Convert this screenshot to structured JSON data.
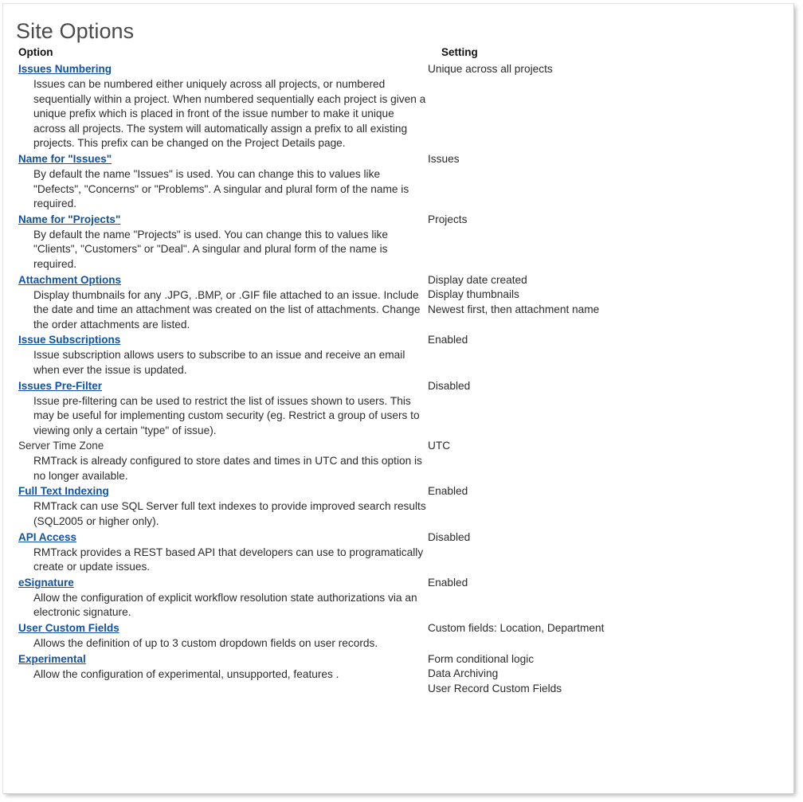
{
  "page": {
    "title": "Site Options",
    "link_color": "#1152a5",
    "text_color": "#2b2b2b",
    "title_color": "#4a4a4a",
    "background": "#ffffff"
  },
  "columns": {
    "option_header": "Option",
    "setting_header": "Setting"
  },
  "rows": [
    {
      "name": "Issues Numbering",
      "is_link": true,
      "description": "Issues can be numbered either uniquely across all projects, or numbered sequentially within a project. When numbered sequentially each project is given a unique prefix which is placed in front of the issue number to make it unique across all projects. The system will automatically assign a prefix to all existing projects. This prefix can be changed on the Project Details page.",
      "settings": [
        "Unique across all projects"
      ]
    },
    {
      "name": "Name for \"Issues\"",
      "is_link": true,
      "description": "By default the name \"Issues\" is used. You can change this to values like \"Defects\", \"Concerns\" or \"Problems\". A singular and plural form of the name is required.",
      "settings": [
        "Issues"
      ]
    },
    {
      "name": "Name for \"Projects\"",
      "is_link": true,
      "description": "By default the name \"Projects\" is used. You can change this to values like \"Clients\", \"Customers\" or \"Deal\". A singular and plural form of the name is required.",
      "settings": [
        "Projects"
      ]
    },
    {
      "name": "Attachment Options",
      "is_link": true,
      "description": "Display thumbnails for any .JPG, .BMP, or .GIF file attached to an issue. Include the date and time an attachment was created on the list of attachments. Change the order attachments are listed.",
      "settings": [
        "Display date created",
        "Display thumbnails",
        "Newest first, then attachment name"
      ]
    },
    {
      "name": "Issue Subscriptions",
      "is_link": true,
      "description": "Issue subscription allows users to subscribe to an issue and receive an email when ever the issue is updated.",
      "settings": [
        "Enabled"
      ]
    },
    {
      "name": "Issues Pre-Filter",
      "is_link": true,
      "description": "Issue pre-filtering can be used to restrict the list of issues shown to users. This may be useful for implementing custom security (eg. Restrict a group of users to viewing only a certain \"type\" of issue).",
      "settings": [
        "Disabled"
      ]
    },
    {
      "name": "Server Time Zone",
      "is_link": false,
      "description": "RMTrack is already configured to store dates and times in UTC and this option is no longer available.",
      "settings": [
        "UTC"
      ]
    },
    {
      "name": "Full Text Indexing",
      "is_link": true,
      "description": "RMTrack can use SQL Server full text indexes to provide improved search results (SQL2005 or higher only).",
      "settings": [
        "Enabled"
      ]
    },
    {
      "name": "API Access",
      "is_link": true,
      "description": "RMTrack provides a REST based API that developers can use to programatically create or update issues.",
      "settings": [
        "Disabled"
      ]
    },
    {
      "name": "eSignature",
      "is_link": true,
      "description": "Allow the configuration of explicit workflow resolution state authorizations via an electronic signature.",
      "settings": [
        "Enabled"
      ]
    },
    {
      "name": "User Custom Fields",
      "is_link": true,
      "description": "Allows the definition of up to 3 custom dropdown fields on user records.",
      "settings": [
        "Custom fields: Location, Department"
      ]
    },
    {
      "name": "Experimental",
      "is_link": true,
      "description": "Allow the configuration of experimental, unsupported, features .",
      "settings": [
        "Form conditional logic",
        "Data Archiving",
        "User Record Custom Fields"
      ]
    }
  ]
}
